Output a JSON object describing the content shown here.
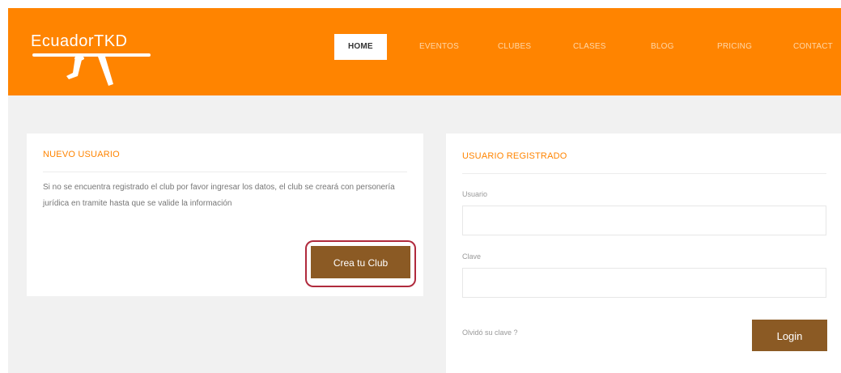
{
  "brand": {
    "logo_text": "EcuadorTKD"
  },
  "nav": {
    "items": [
      {
        "label": "HOME"
      },
      {
        "label": "EVENTOS"
      },
      {
        "label": "CLUBES"
      },
      {
        "label": "CLASES"
      },
      {
        "label": "BLOG"
      },
      {
        "label": "PRICING"
      },
      {
        "label": "CONTACT"
      }
    ],
    "active": "HOME"
  },
  "new_user": {
    "title": "NUEVO USUARIO",
    "description": "Si no se encuentra registrado el club por favor ingresar los datos, el club se creará con personería jurídica en tramite hasta que se valide la información",
    "button": "Crea tu Club"
  },
  "registered_user": {
    "title": "USUARIO REGISTRADO",
    "user_label": "Usuario",
    "user_value": "",
    "password_label": "Clave",
    "password_value": "",
    "forgot": "Olvidó su clave ?",
    "button": "Login"
  },
  "colors": {
    "header": "#ff8400",
    "accent": "#ff8400",
    "button": "#8b5a24",
    "highlight_outline": "#b02a3d",
    "background": "#f1f1f1"
  },
  "icons": {
    "logo_graphic": "taekwondo-kicker-icon"
  }
}
